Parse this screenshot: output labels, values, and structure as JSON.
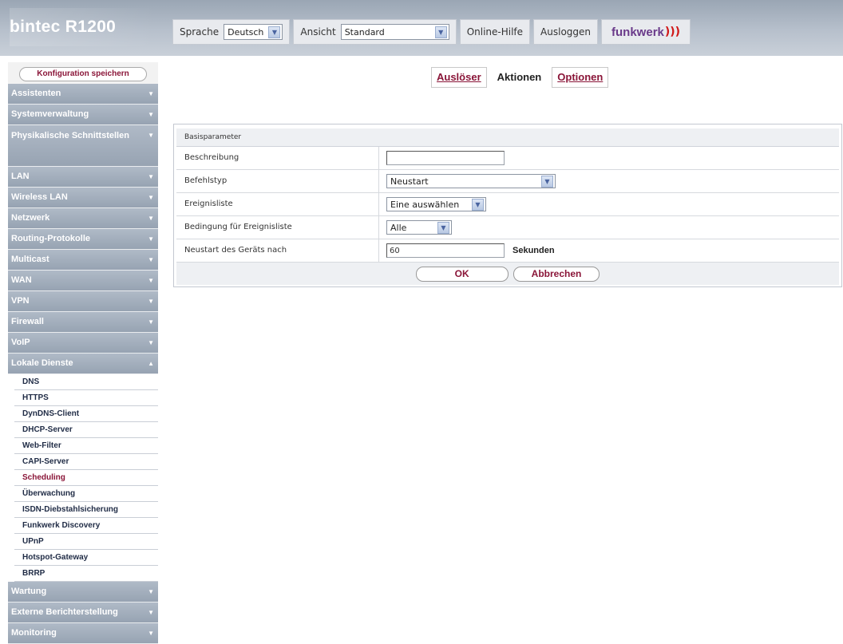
{
  "header": {
    "brand": "bintec R1200",
    "language_label": "Sprache",
    "language_value": "Deutsch",
    "view_label": "Ansicht",
    "view_value": "Standard",
    "help_link": "Online-Hilfe",
    "logout_link": "Ausloggen",
    "logo_text": "funkwerk",
    "logo_waves": ")))"
  },
  "sidebar": {
    "save_button": "Konfiguration speichern",
    "items": [
      {
        "label": "Assistenten",
        "arrow": "▼"
      },
      {
        "label": "Systemverwaltung",
        "arrow": "▼"
      },
      {
        "label": "Physikalische Schnittstellen",
        "arrow": "▼"
      },
      {
        "label": "LAN",
        "arrow": "▼"
      },
      {
        "label": "Wireless LAN",
        "arrow": "▼"
      },
      {
        "label": "Netzwerk",
        "arrow": "▼"
      },
      {
        "label": "Routing-Protokolle",
        "arrow": "▼"
      },
      {
        "label": "Multicast",
        "arrow": "▼"
      },
      {
        "label": "WAN",
        "arrow": "▼"
      },
      {
        "label": "VPN",
        "arrow": "▼"
      },
      {
        "label": "Firewall",
        "arrow": "▼"
      },
      {
        "label": "VoIP",
        "arrow": "▼"
      },
      {
        "label": "Lokale Dienste",
        "arrow": "▲"
      },
      {
        "label": "Wartung",
        "arrow": "▼"
      },
      {
        "label": "Externe Berichterstellung",
        "arrow": "▼"
      },
      {
        "label": "Monitoring",
        "arrow": "▼"
      }
    ],
    "subitems": [
      "DNS",
      "HTTPS",
      "DynDNS-Client",
      "DHCP-Server",
      "Web-Filter",
      "CAPI-Server",
      "Scheduling",
      "Überwachung",
      "ISDN-Diebstahlsicherung",
      "Funkwerk Discovery",
      "UPnP",
      "Hotspot-Gateway",
      "BRRP"
    ],
    "active_subitem": "Scheduling"
  },
  "tabs": [
    {
      "label": "Auslöser",
      "active": false
    },
    {
      "label": "Aktionen",
      "active": true
    },
    {
      "label": "Optionen",
      "active": false
    }
  ],
  "form": {
    "section_title": "Basisparameter",
    "description_label": "Beschreibung",
    "description_value": "",
    "command_label": "Befehlstyp",
    "command_value": "Neustart",
    "eventlist_label": "Ereignisliste",
    "eventlist_value": "Eine auswählen",
    "condition_label": "Bedingung für Ereignisliste",
    "condition_value": "Alle",
    "reboot_label": "Neustart des Geräts nach",
    "reboot_value": "60",
    "reboot_unit": "Sekunden",
    "ok_button": "OK",
    "cancel_button": "Abbrechen"
  },
  "colors": {
    "accent": "#8a1538",
    "menu_bg": "#a3aebb",
    "header_bg": "#b7c0cc"
  }
}
